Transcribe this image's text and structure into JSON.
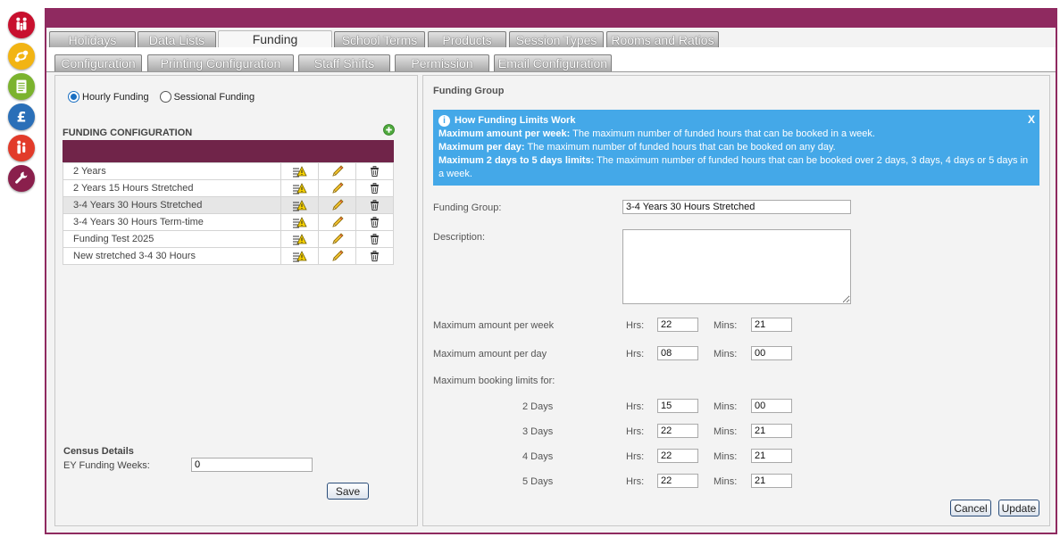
{
  "tabs_row1": [
    {
      "label": "Holidays",
      "active": false
    },
    {
      "label": "Data Lists",
      "active": false
    },
    {
      "label": "Funding",
      "active": true
    },
    {
      "label": "School Terms",
      "active": false
    },
    {
      "label": "Products",
      "active": false
    },
    {
      "label": "Session Types",
      "active": false
    },
    {
      "label": "Rooms and Ratios",
      "active": false
    }
  ],
  "tabs_row2": [
    {
      "label": "Configuration"
    },
    {
      "label": "Printing Configuration"
    },
    {
      "label": "Staff Shifts"
    },
    {
      "label": "Permission"
    },
    {
      "label": "Email Configuration"
    }
  ],
  "colors": {
    "brand": "#8f2a60",
    "header": "#702449",
    "info_bg": "#44a8e8"
  },
  "left": {
    "radio_hourly": "Hourly Funding",
    "radio_sessional": "Sessional Funding",
    "selected": "hourly",
    "config_title": "FUNDING CONFIGURATION",
    "rows": [
      {
        "name": "2 Years",
        "selected": false
      },
      {
        "name": "2 Years 15 Hours Stretched",
        "selected": false
      },
      {
        "name": "3-4 Years 30 Hours Stretched",
        "selected": true
      },
      {
        "name": "3-4 Years 30 Hours Term-time",
        "selected": false
      },
      {
        "name": "Funding Test 2025",
        "selected": false
      },
      {
        "name": "New stretched 3-4 30 Hours",
        "selected": false
      }
    ],
    "census_title": "Census Details",
    "census_label": "EY Funding Weeks:",
    "census_value": "0",
    "save_label": "Save"
  },
  "right": {
    "title": "Funding Group",
    "info": {
      "heading": "How Funding Limits Work",
      "close": "X",
      "lines": [
        {
          "bold": "Maximum amount per week:",
          "text": " The maximum number of funded hours that can be booked in a week."
        },
        {
          "bold": "Maximum per day:",
          "text": " The maximum number of funded hours that can be booked on any day."
        },
        {
          "bold": "Maximum 2 days to 5 days limits:",
          "text": " The maximum number of funded hours that can be booked over 2 days, 3 days, 4 days or 5 days in a week."
        }
      ]
    },
    "funding_group_label": "Funding Group:",
    "funding_group_value": "3-4 Years 30 Hours Stretched",
    "description_label": "Description:",
    "description_value": "",
    "hrs_label": "Hrs:",
    "mins_label": "Mins:",
    "per_week_label": "Maximum amount per week",
    "per_week": {
      "hrs": "22",
      "mins": "21"
    },
    "per_day_label": "Maximum amount per day",
    "per_day": {
      "hrs": "08",
      "mins": "00"
    },
    "booking_limits_label": "Maximum booking limits for:",
    "limits": [
      {
        "label": "2 Days",
        "hrs": "15",
        "mins": "00"
      },
      {
        "label": "3 Days",
        "hrs": "22",
        "mins": "21"
      },
      {
        "label": "4 Days",
        "hrs": "22",
        "mins": "21"
      },
      {
        "label": "5 Days",
        "hrs": "22",
        "mins": "21"
      }
    ],
    "cancel_label": "Cancel",
    "update_label": "Update"
  },
  "side_icons": [
    "family-icon",
    "workflow-icon",
    "notepad-icon",
    "pound-icon",
    "children-icon",
    "wrench-icon"
  ]
}
